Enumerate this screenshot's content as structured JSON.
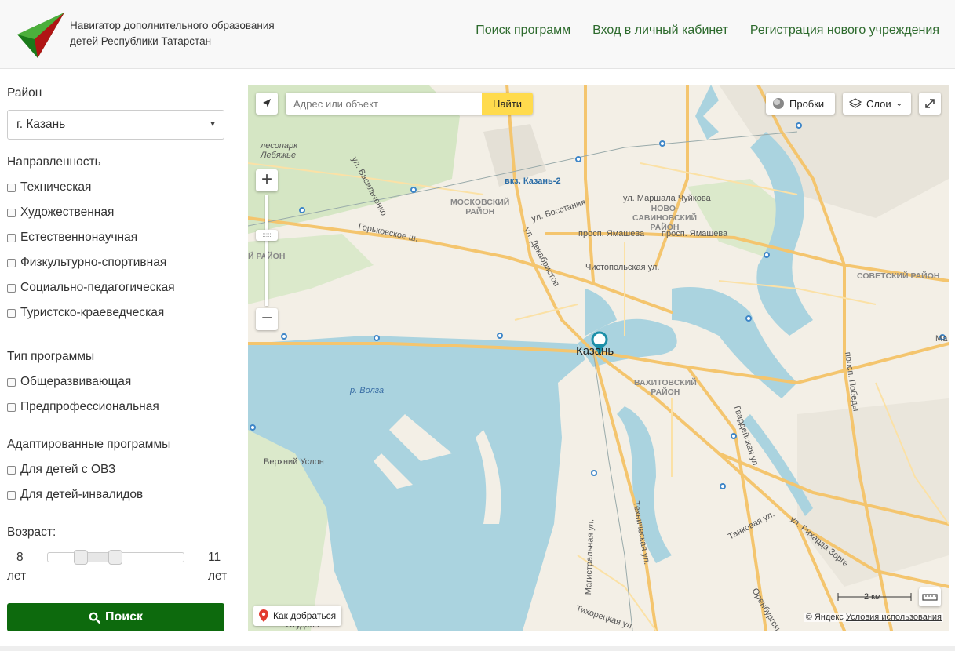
{
  "header": {
    "brand_line1": "Навигатор дополнительного образования",
    "brand_line2": "детей Республики Татарстан",
    "nav": [
      "Поиск программ",
      "Вход в личный кабинет",
      "Регистрация нового учреждения"
    ],
    "accent": "#2d6a2d"
  },
  "filters": {
    "district_label": "Район",
    "district_value": "г. Казань",
    "direction_label": "Направленность",
    "directions": [
      "Техническая",
      "Художественная",
      "Естественнонаучная",
      "Физкультурно-спортивная",
      "Социально-педагогическая",
      "Туристско-краеведческая"
    ],
    "program_type_label": "Тип программы",
    "program_types": [
      "Общеразвивающая",
      "Предпрофессиональная"
    ],
    "adapted_label": "Адаптированные программы",
    "adapted": [
      "Для детей с ОВЗ",
      "Для детей-инвалидов"
    ],
    "age_label": "Возраст:",
    "age_min": "8",
    "age_max": "11",
    "age_unit": "лет",
    "age_min_fraction": 0.24,
    "age_max_fraction": 0.49,
    "search_label": "Поиск",
    "search_color": "#0d6a0d"
  },
  "map": {
    "address_placeholder": "Адрес или объект",
    "find_label": "Найти",
    "traffic_label": "Пробки",
    "layers_label": "Слои",
    "route_label": "Как добраться",
    "scale_label": "2 км",
    "copyright": "© Яндекс",
    "terms": "Условия использования",
    "labels": {
      "lebyazhye": "лесопарк\nЛебяжье",
      "vasilchenko": "ул. Васильченко",
      "kazan2": "вкз. Казань-2",
      "moskovsky": "МОСКОВСКИЙ\nРАЙОН",
      "vosstaniya": "ул. Восстания",
      "chuykova": "ул. Маршала Чуйкова",
      "novosavinsky": "НОВО-\nСАВИНОВСКИЙ\nРАЙОН",
      "gorkovskoe": "Горьковское ш.",
      "dekabristov": "ул. Декабристов",
      "yamasheva1": "просп. Ямашева",
      "yamasheva2": "просп. Ямашева",
      "chistopolskaya": "Чистопольская ул.",
      "sovetsky": "СОВЕТСКИЙ РАЙОН",
      "raion_left": "Й РАЙОН",
      "kazan": "Казань",
      "vakhitovsky": "ВАХИТОВСКИЙ\nРАЙОН",
      "volga": "р. Волга",
      "pobedy": "просп. Победы",
      "gvardeyskaya": "Гвардейская ул.",
      "verkhniy_uslon": "Верхний Услон",
      "tankovaya": "Танковая ул.",
      "zorge": "ул. Рихарда Зорге",
      "magistralnaya": "Магистральная ул.",
      "tekhnicheskaya": "Техническая ул.",
      "tikhoretskaya": "Тихорецкая ул.",
      "orenburgsky": "Оренбургский",
      "ma": "Ма",
      "studench": "Студенч"
    }
  }
}
